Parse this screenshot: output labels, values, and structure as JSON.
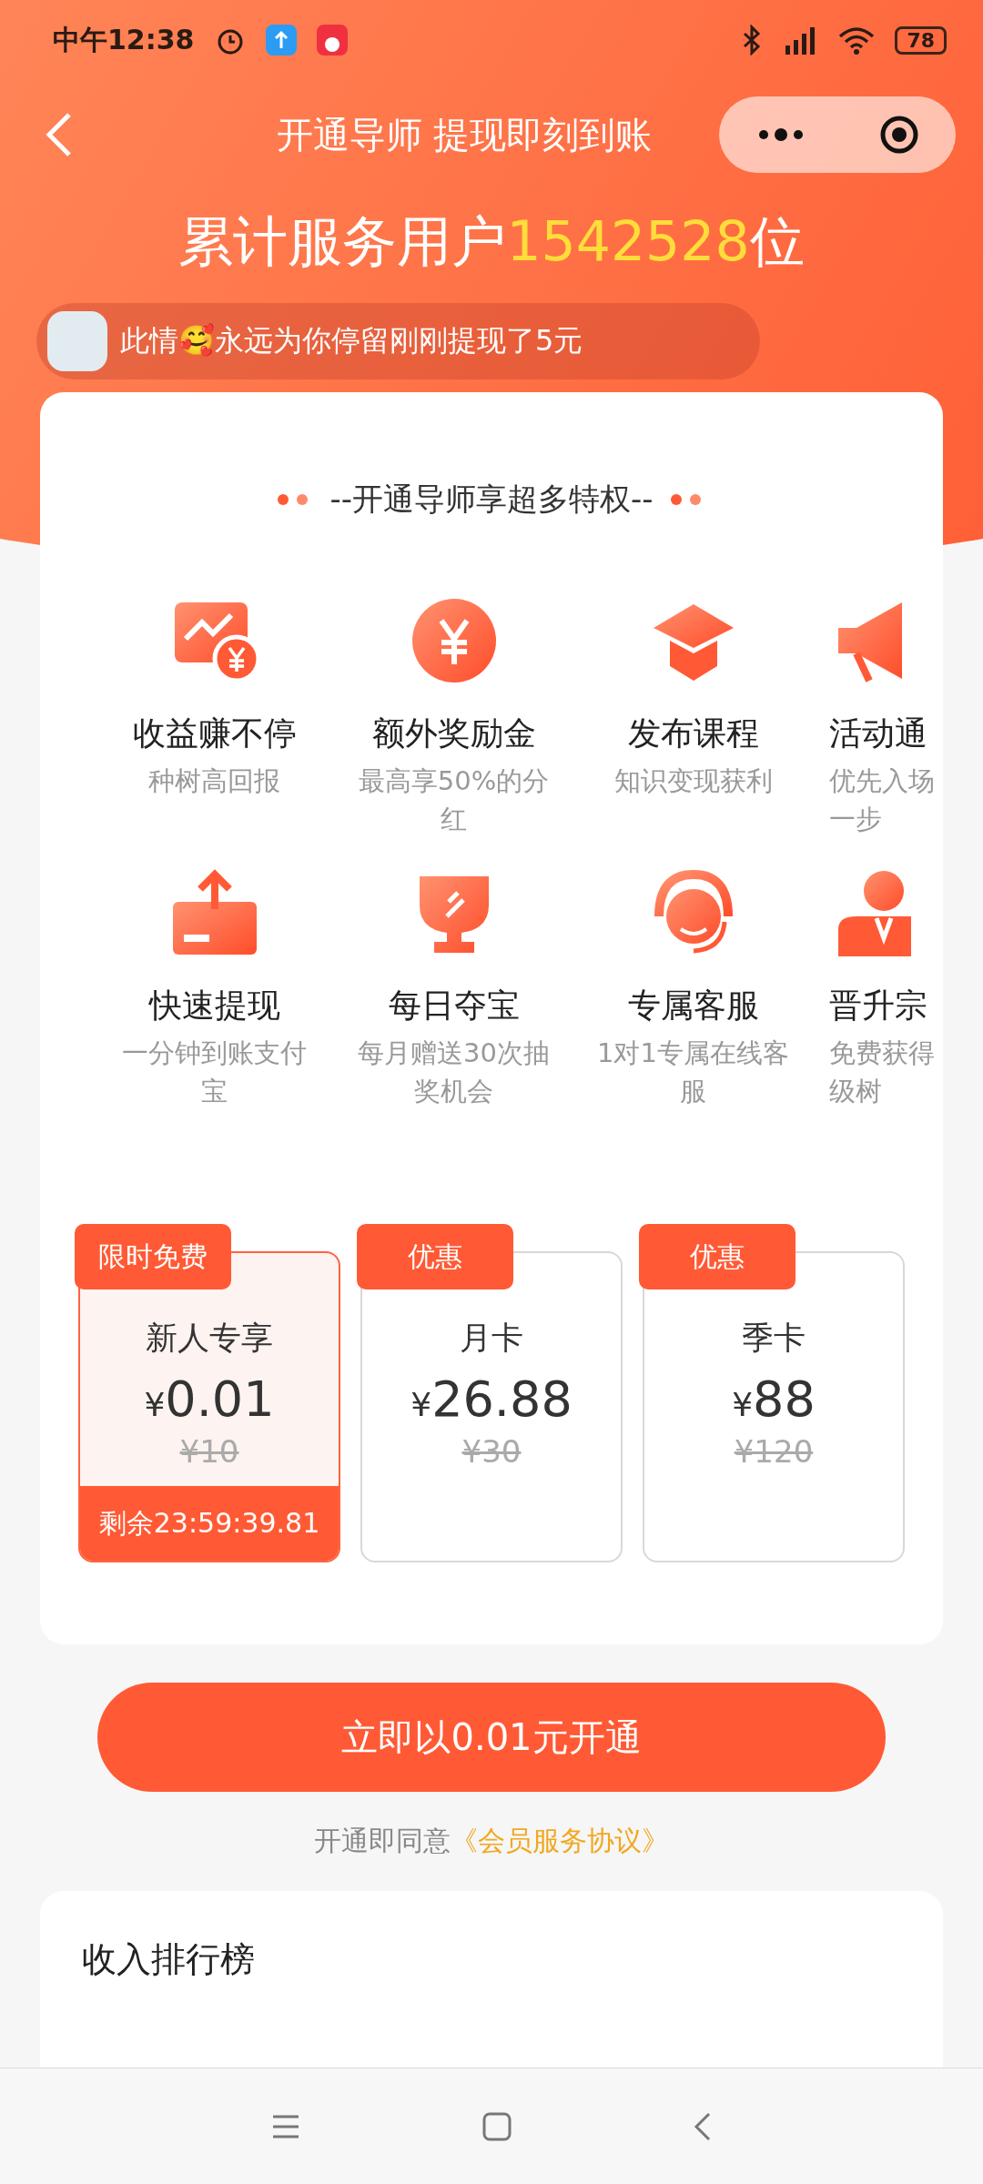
{
  "status_bar": {
    "time": "中午12:38",
    "battery": "78"
  },
  "header": {
    "title": "开通导师 提现即刻到账"
  },
  "stats": {
    "prefix": "累计服务用户",
    "count": "1542528",
    "suffix": "位"
  },
  "ticker": {
    "text": "此情🥰永远为你停留刚刚提现了5元"
  },
  "privileges": {
    "heading": "--开通导师享超多特权--",
    "items": [
      {
        "title": "收益赚不停",
        "subtitle": "种树高回报"
      },
      {
        "title": "额外奖励金",
        "subtitle": "最高享50%的分红"
      },
      {
        "title": "发布课程",
        "subtitle": "知识变现获利"
      },
      {
        "title": "活动通",
        "subtitle": "优先入场一步"
      },
      {
        "title": "快速提现",
        "subtitle": "一分钟到账支付宝"
      },
      {
        "title": "每日夺宝",
        "subtitle": "每月赠送30次抽奖机会"
      },
      {
        "title": "专属客服",
        "subtitle": "1对1专属在线客服"
      },
      {
        "title": "晋升宗",
        "subtitle": "免费获得级树"
      }
    ]
  },
  "plans": [
    {
      "tag": "限时免费",
      "name": "新人专享",
      "currency": "¥",
      "amount": "0.01",
      "original": "¥10",
      "countdown": "剩余23:59:39.81",
      "selected": true
    },
    {
      "tag": "优惠",
      "name": "月卡",
      "currency": "¥",
      "amount": "26.88",
      "original": "¥30",
      "selected": false
    },
    {
      "tag": "优惠",
      "name": "季卡",
      "currency": "¥",
      "amount": "88",
      "original": "¥120",
      "selected": false
    }
  ],
  "cta": {
    "label": "立即以0.01元开通"
  },
  "agreement": {
    "prefix": "开通即同意",
    "link": "《会员服务协议》"
  },
  "ranking": {
    "title": "收入排行榜"
  }
}
